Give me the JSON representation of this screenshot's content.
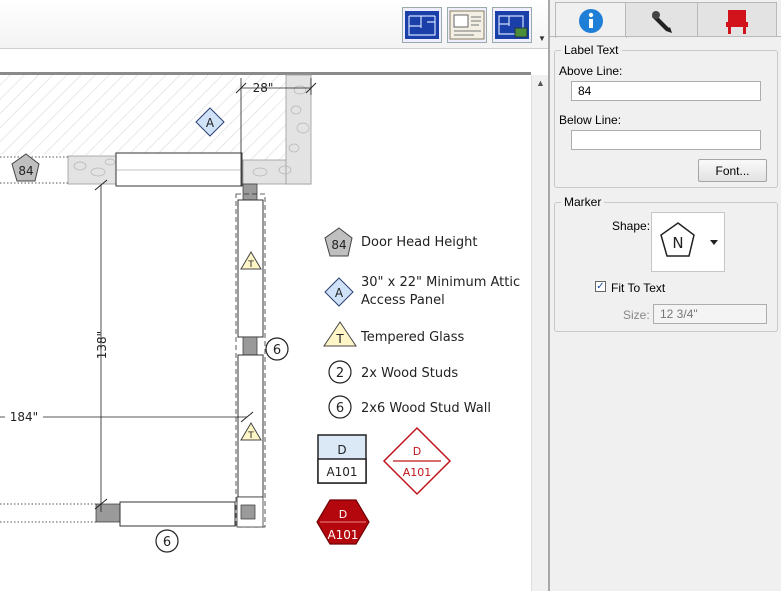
{
  "toolbar": {
    "buttons": [
      {
        "name": "plan-view-icon"
      },
      {
        "name": "layout-view-icon"
      },
      {
        "name": "camera-view-icon"
      }
    ],
    "more_glyph": "▼"
  },
  "drawing": {
    "dims": {
      "top": "28\"",
      "vertical": "138\"",
      "horizontal": "184\""
    },
    "markers": {
      "pentagon": "84",
      "diamond": "A",
      "triangle": "T",
      "circle6": "6"
    },
    "legend": [
      {
        "symbol": "84",
        "text1": "Door Head Height",
        "text2": ""
      },
      {
        "symbol": "A",
        "text1": "30\" x 22\" Minimum Attic",
        "text2": "Access Panel"
      },
      {
        "symbol": "T",
        "text1": "Tempered Glass",
        "text2": ""
      },
      {
        "symbol": "2",
        "text1": "2x Wood Studs",
        "text2": ""
      },
      {
        "symbol": "6",
        "text1": "2x6 Wood Stud Wall",
        "text2": ""
      }
    ],
    "callouts": {
      "box": {
        "top": "D",
        "bottom": "A101"
      },
      "diamond": {
        "top": "D",
        "bottom": "A101"
      },
      "hexagon": {
        "top": "D",
        "bottom": "A101"
      }
    },
    "colors": {
      "pentagon_fill": "#bfbfbf",
      "diamond_fill": "#cfe2f7",
      "triangle_fill": "#fff6c8",
      "box_fill": "#dbe9f7",
      "callout_red": "#c0161b",
      "hex_fill": "#b3070d"
    }
  },
  "panel": {
    "tabs": [
      {
        "name": "info-icon"
      },
      {
        "name": "pen-icon"
      },
      {
        "name": "chair-icon"
      }
    ],
    "label_text": {
      "title": "Label Text",
      "above_label": "Above Line:",
      "above_value": "84",
      "below_label": "Below Line:",
      "below_value": "",
      "font_button": "Font..."
    },
    "marker": {
      "title": "Marker",
      "shape_label": "Shape:",
      "shape_letter": "N",
      "fit_to_text": "Fit To Text",
      "fit_checked": "✓",
      "size_label": "Size:",
      "size_value": "12 3/4\""
    },
    "colors": {
      "info_blue": "#1f7fd6",
      "chair_red": "#d2131b"
    }
  }
}
